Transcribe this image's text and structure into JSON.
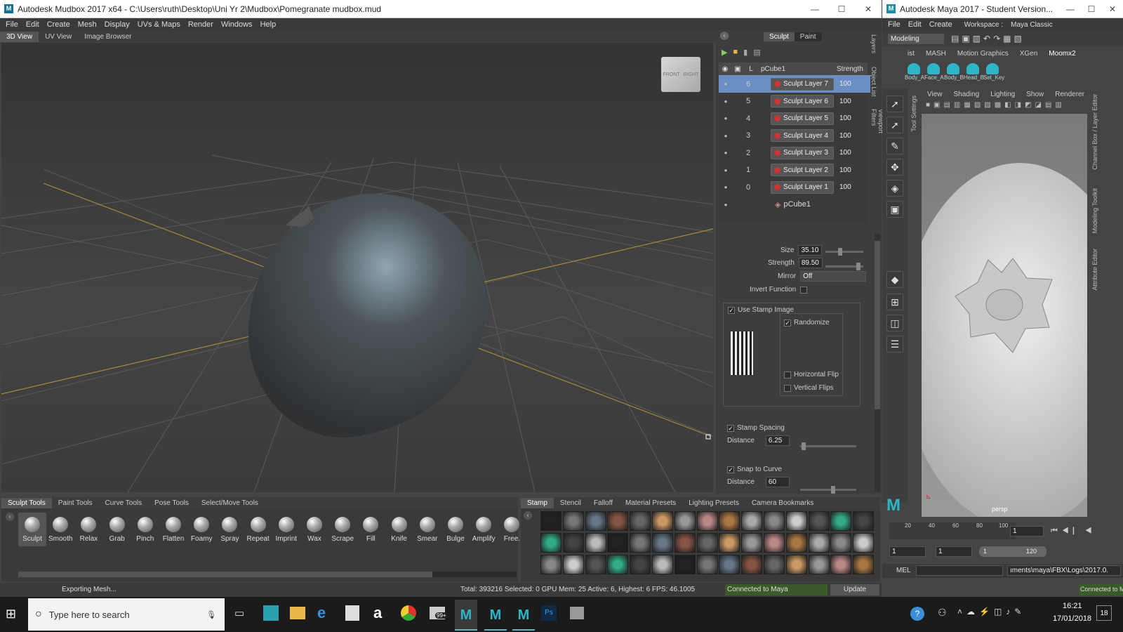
{
  "mudbox": {
    "title": "Autodesk Mudbox 2017 x64 - C:\\Users\\ruth\\Desktop\\Uni Yr 2\\Mudbox\\Pomegranate mudbox.mud",
    "logo": "M",
    "menu": [
      "File",
      "Edit",
      "Create",
      "Mesh",
      "Display",
      "UVs & Maps",
      "Render",
      "Windows",
      "Help"
    ],
    "view_tabs": [
      "3D View",
      "UV View",
      "Image Browser"
    ],
    "viewcube": {
      "front": "FRONT",
      "right": "RIGHT"
    },
    "panel_tabs": [
      "Sculpt",
      "Paint"
    ],
    "layers_header": {
      "L": "L",
      "name": "pCube1",
      "strength": "Strength"
    },
    "layers": [
      {
        "num": "6",
        "name": "Sculpt Layer 7",
        "strength": "100"
      },
      {
        "num": "5",
        "name": "Sculpt Layer 6",
        "strength": "100"
      },
      {
        "num": "4",
        "name": "Sculpt Layer 5",
        "strength": "100"
      },
      {
        "num": "3",
        "name": "Sculpt Layer 4",
        "strength": "100"
      },
      {
        "num": "2",
        "name": "Sculpt Layer 3",
        "strength": "100"
      },
      {
        "num": "1",
        "name": "Sculpt Layer 2",
        "strength": "100"
      },
      {
        "num": "0",
        "name": "Sculpt Layer 1",
        "strength": "100"
      }
    ],
    "base_layer": "pCube1",
    "side_tabs": [
      "Layers",
      "Object List",
      "Viewport Filters"
    ],
    "props": {
      "size_label": "Size",
      "size": "35.10",
      "strength_label": "Strength",
      "strength": "89.50",
      "mirror_label": "Mirror",
      "mirror": "Off",
      "invert_label": "Invert Function",
      "use_stamp": "Use Stamp Image",
      "randomize": "Randomize",
      "hflip": "Horizontal Flip",
      "vflip": "Vertical Flips",
      "stamp_spacing": "Stamp Spacing",
      "distance_label": "Distance",
      "distance": "6.25",
      "snap": "Snap to Curve",
      "distance2_label": "Distance",
      "distance2": "60"
    },
    "tool_tabs": [
      "Sculpt Tools",
      "Paint Tools",
      "Curve Tools",
      "Pose Tools",
      "Select/Move Tools"
    ],
    "tools": [
      "Sculpt",
      "Smooth",
      "Relax",
      "Grab",
      "Pinch",
      "Flatten",
      "Foamy",
      "Spray",
      "Repeat",
      "Imprint",
      "Wax",
      "Scrape",
      "Fill",
      "Knife",
      "Smear",
      "Bulge",
      "Amplify",
      "Free."
    ],
    "tray_tabs": [
      "Stamp",
      "Stencil",
      "Falloff",
      "Material Presets",
      "Lighting Presets",
      "Camera Bookmarks"
    ],
    "status_left": "Exporting Mesh...",
    "status_stats": "Total: 393216  Selected: 0 GPU Mem: 25  Active: 6, Highest: 6  FPS: 46.1005",
    "status_connected": "Connected to Maya",
    "update_label": "Update"
  },
  "maya": {
    "title": "Autodesk Maya 2017 - Student Version...",
    "menu": [
      "File",
      "Edit",
      "Create"
    ],
    "workspace_label": "Workspace :",
    "workspace": "Maya Classic",
    "mode": "Modeling",
    "shelf_tabs": [
      "ist",
      "MASH",
      "Motion Graphics",
      "XGen",
      "Moomx2"
    ],
    "shelf_items": [
      "Body_A",
      "Face_A",
      "Body_B",
      "Head_B",
      "Set_Key"
    ],
    "panel_menu": [
      "View",
      "Shading",
      "Lighting",
      "Show",
      "Renderer"
    ],
    "right_tabs": [
      "Channel Box / Layer Editor",
      "Modeling Toolkit",
      "Attribute Editor"
    ],
    "left_tab": "Tool Settings",
    "camera": "persp",
    "timeline_ticks": [
      "20",
      "40",
      "60",
      "80",
      "100"
    ],
    "frame_current": "1",
    "range": {
      "start": "1",
      "inner_start": "1",
      "inner_left": "1",
      "inner_end": "120"
    },
    "mel": "MEL",
    "mel_output": "ıments\\maya\\FBX\\Logs\\2017.0.",
    "connected": "Connected to M"
  },
  "taskbar": {
    "search": "Type here to search",
    "time": "16:21",
    "date": "17/01/2018",
    "mail_badge": "99+",
    "notifications": "18",
    "apps": [
      "task-view",
      "store",
      "file-explorer",
      "edge",
      "shopping-bag",
      "amazon",
      "chrome",
      "mail",
      "mudbox-1",
      "mudbox-2",
      "mudbox-3",
      "photoshop",
      "misc"
    ]
  },
  "colors": {
    "layer_selected": "#6a8fc4",
    "accent_green": "#3a5a2a",
    "maya_teal": "#2fb5c8"
  }
}
